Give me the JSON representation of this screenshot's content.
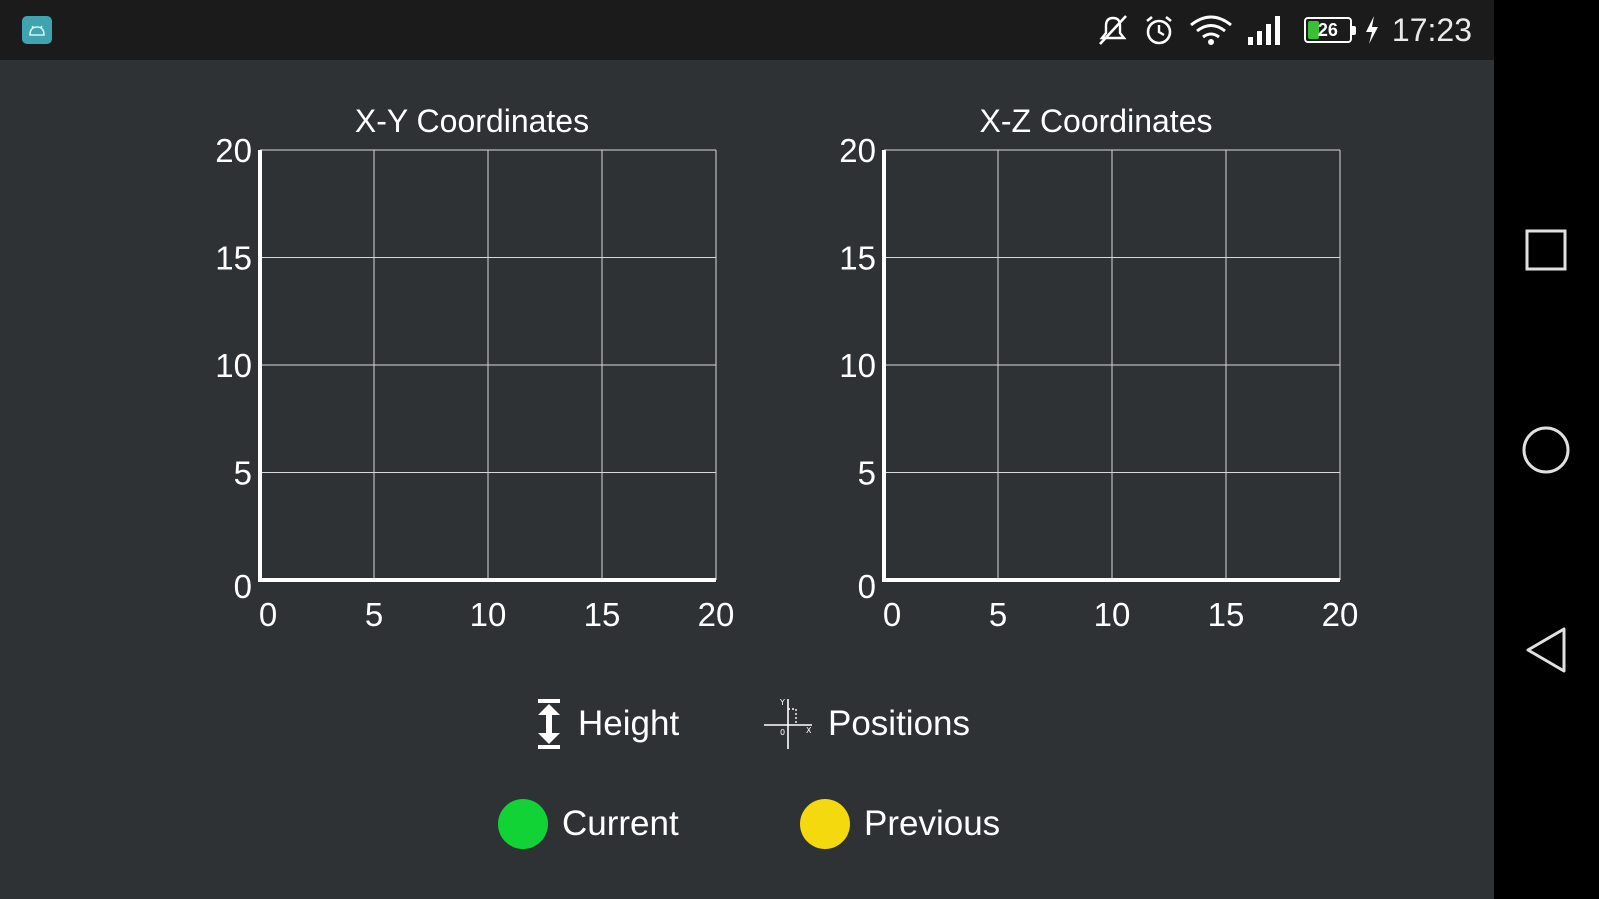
{
  "status_bar": {
    "time": "17:23",
    "battery_level": "26",
    "battery_fraction": 0.26,
    "icons": [
      "app-icon",
      "mute-icon",
      "alarm-icon",
      "wifi-icon",
      "signal-icon",
      "battery-icon",
      "charging-icon"
    ]
  },
  "nav_bar": {
    "icons": [
      "recent-apps-icon",
      "home-icon",
      "back-icon"
    ]
  },
  "chart_data": [
    {
      "type": "scatter",
      "title": "X-Y Coordinates",
      "xlabel": "",
      "ylabel": "",
      "xlim": [
        0,
        20
      ],
      "ylim": [
        0,
        20
      ],
      "xticks": [
        "0",
        "5",
        "10",
        "15",
        "20"
      ],
      "yticks": [
        "0",
        "5",
        "10",
        "15",
        "20"
      ],
      "grid": true,
      "series": []
    },
    {
      "type": "scatter",
      "title": "X-Z Coordinates",
      "xlabel": "",
      "ylabel": "",
      "xlim": [
        0,
        20
      ],
      "ylim": [
        0,
        20
      ],
      "xticks": [
        "0",
        "5",
        "10",
        "15",
        "20"
      ],
      "yticks": [
        "0",
        "5",
        "10",
        "15",
        "20"
      ],
      "grid": true,
      "series": []
    }
  ],
  "controls": {
    "height_label": "Height",
    "positions_label": "Positions"
  },
  "legend": {
    "current_label": "Current",
    "previous_label": "Previous",
    "current_color": "#12d335",
    "previous_color": "#f5d90f"
  },
  "colors": {
    "background": "#2e3235",
    "status_bar": "#1b1b1b",
    "grid": "#d8d8d8",
    "axis": "#ffffff"
  }
}
